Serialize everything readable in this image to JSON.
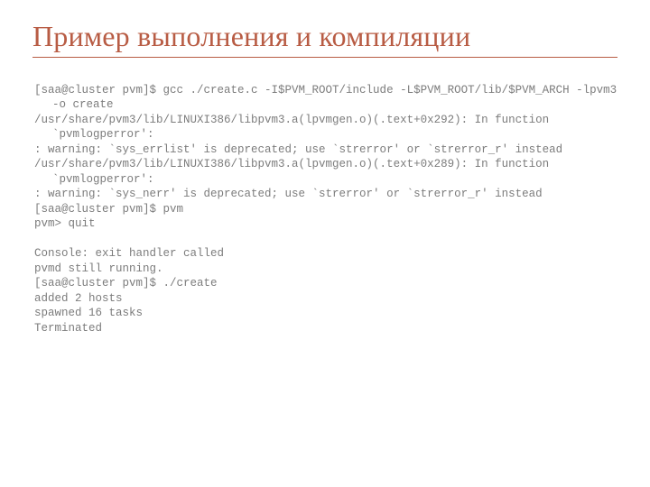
{
  "title": "Пример выполнения и компиляции",
  "terminal": {
    "lines": [
      "[saa@cluster pvm]$ gcc ./create.c -I$PVM_ROOT/include -L$PVM_ROOT/lib/$PVM_ARCH -lpvm3 -o create",
      "/usr/share/pvm3/lib/LINUXI386/libpvm3.a(lpvmgen.o)(.text+0x292): In function `pvmlogperror':",
      ": warning: `sys_errlist' is deprecated; use `strerror' or `strerror_r' instead",
      "/usr/share/pvm3/lib/LINUXI386/libpvm3.a(lpvmgen.o)(.text+0x289): In function `pvmlogperror':",
      ": warning: `sys_nerr' is deprecated; use `strerror' or `strerror_r' instead",
      "[saa@cluster pvm]$ pvm",
      "pvm> quit",
      "",
      "Console: exit handler called",
      "pvmd still running.",
      "[saa@cluster pvm]$ ./create",
      "added 2 hosts",
      "spawned 16 tasks",
      "Terminated"
    ]
  }
}
